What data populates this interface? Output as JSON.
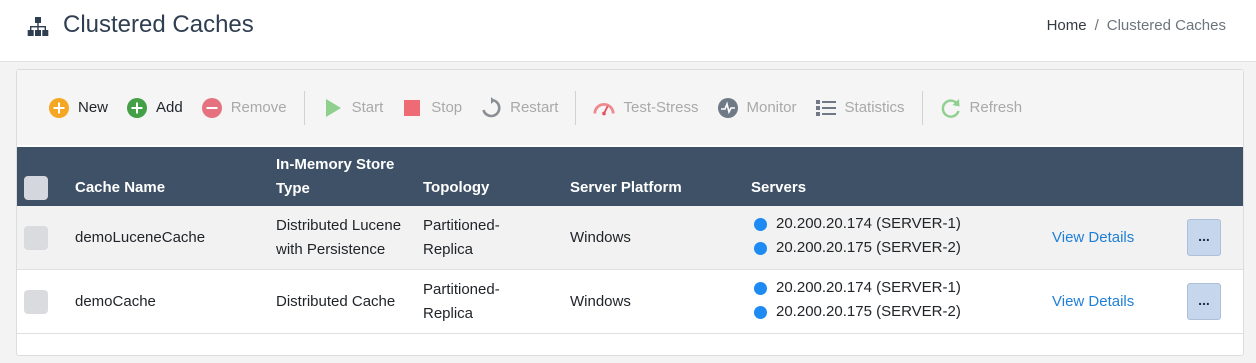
{
  "header": {
    "title": "Clustered Caches",
    "breadcrumb": {
      "home": "Home",
      "separator": "/",
      "current": "Clustered Caches"
    }
  },
  "toolbar": {
    "new": "New",
    "add": "Add",
    "remove": "Remove",
    "start": "Start",
    "stop": "Stop",
    "restart": "Restart",
    "test_stress": "Test-Stress",
    "monitor": "Monitor",
    "statistics": "Statistics",
    "refresh": "Refresh"
  },
  "table": {
    "headers": {
      "cache_name": "Cache Name",
      "store_type_line1": "In-Memory Store",
      "store_type_line2": "Type",
      "topology": "Topology",
      "platform": "Server Platform",
      "servers": "Servers"
    },
    "rows": [
      {
        "name": "demoLuceneCache",
        "store_line1": "Distributed Lucene",
        "store_line2": "with Persistence",
        "topology_line1": "Partitioned-",
        "topology_line2": "Replica",
        "platform": "Windows",
        "server1": "20.200.20.174 (SERVER-1)",
        "server2": "20.200.20.175 (SERVER-2)",
        "details": "View Details",
        "more": "..."
      },
      {
        "name": "demoCache",
        "store_line1": "Distributed Cache",
        "store_line2": "",
        "topology_line1": "Partitioned-",
        "topology_line2": "Replica",
        "platform": "Windows",
        "server1": "20.200.20.174 (SERVER-1)",
        "server2": "20.200.20.175 (SERVER-2)",
        "details": "View Details",
        "more": "..."
      }
    ]
  },
  "colors": {
    "header_bg": "#3e5166",
    "link": "#1f7fd6",
    "status_dot": "#1e8bf3",
    "new_icon": "#f5a623",
    "add_icon": "#43a047",
    "remove_icon": "#e5737f"
  }
}
